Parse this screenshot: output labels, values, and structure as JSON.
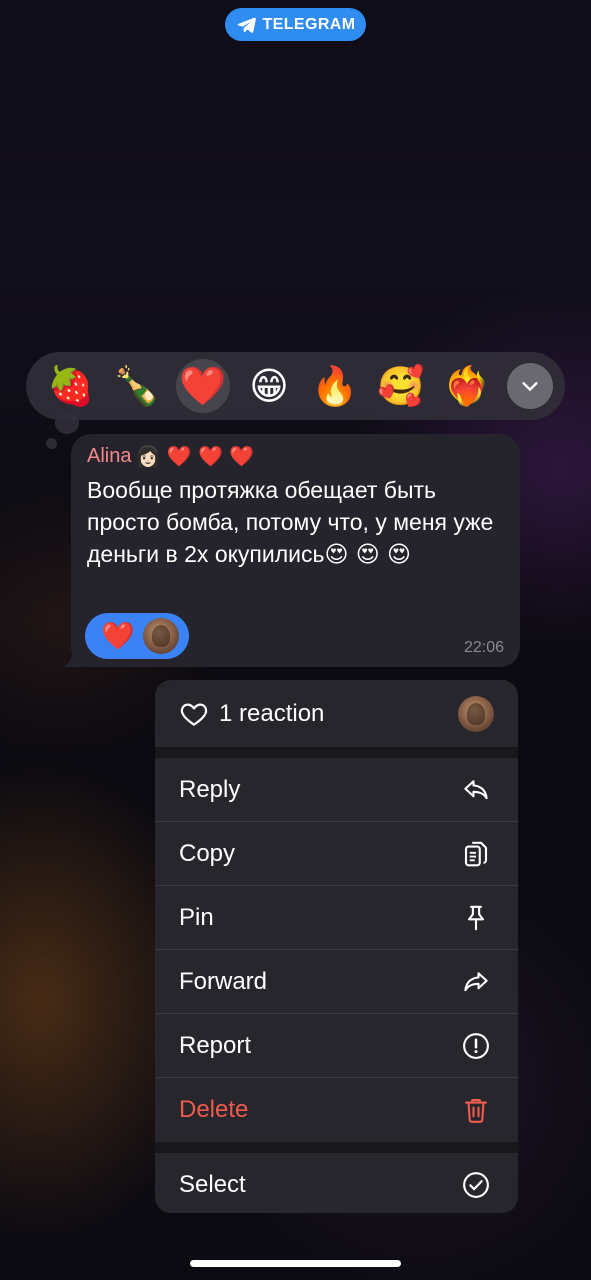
{
  "top_badge": {
    "label": "TELEGRAM"
  },
  "reaction_bar": {
    "emojis": [
      "🍓",
      "🍾",
      "❤️",
      "😁",
      "🔥",
      "🥰",
      "❤️‍🔥"
    ],
    "selected_index": 2
  },
  "message": {
    "sender": "Alina",
    "sender_emojis": "👩🏻 ❤️ ❤️ ❤️",
    "text": "Вообще протяжка обещает быть просто бомба, потому что, у меня уже деньги в 2х окупились",
    "text_emojis": "😍 😍 😍",
    "reaction": "❤️",
    "time": "22:06"
  },
  "menu": {
    "reaction_summary": "1 reaction",
    "items": [
      {
        "label": "Reply",
        "icon": "reply-icon"
      },
      {
        "label": "Copy",
        "icon": "copy-icon"
      },
      {
        "label": "Pin",
        "icon": "pin-icon"
      },
      {
        "label": "Forward",
        "icon": "forward-icon"
      },
      {
        "label": "Report",
        "icon": "report-icon"
      },
      {
        "label": "Delete",
        "icon": "trash-icon",
        "destructive": true
      }
    ],
    "select": {
      "label": "Select",
      "icon": "checkmark-circle-icon"
    }
  },
  "colors": {
    "accent": "#2f8cf0",
    "reaction_chip": "#3b82f6",
    "sender_name": "#f48a8a",
    "destructive": "#ee5b4c"
  }
}
